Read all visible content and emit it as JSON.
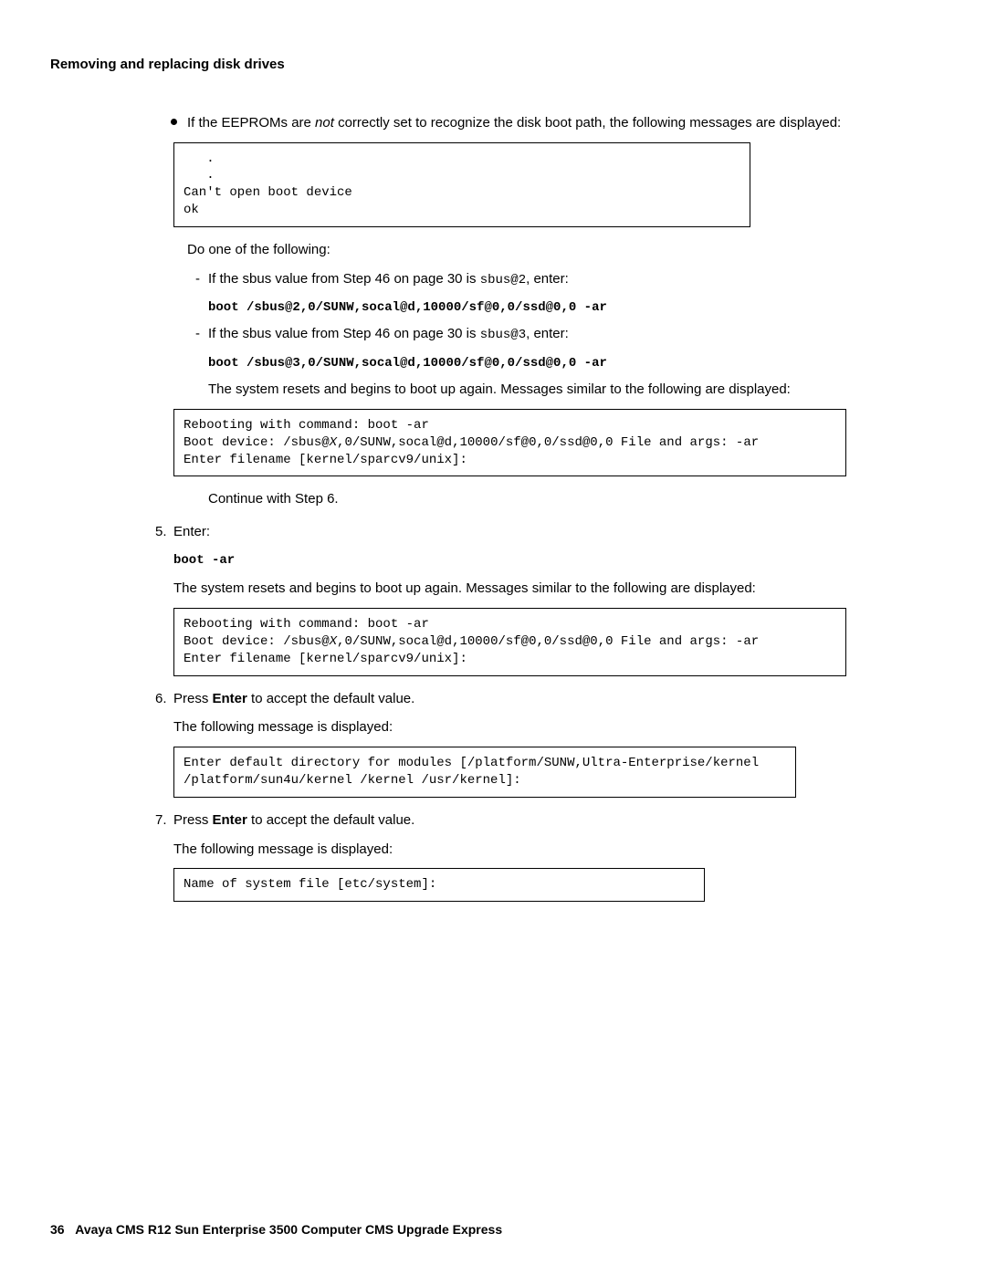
{
  "header": {
    "section": "Removing and replacing disk drives"
  },
  "bullet": {
    "text_a": "If the EEPROMs are ",
    "not": "not",
    "text_b": " correctly set to recognize the disk boot path, the following messages are displayed:"
  },
  "codebox1": "   .\n   .\nCan't open boot device\nok",
  "do_one": "Do one of the following:",
  "dash1_a": "If the sbus value from Step 46 on page 30 is ",
  "dash1_code": "sbus@2",
  "dash1_b": ", enter:",
  "cmd1": "boot /sbus@2,0/SUNW,socal@d,10000/sf@0,0/ssd@0,0 -ar",
  "dash2_a": "If the sbus value from Step 46 on page 30 is ",
  "dash2_code": "sbus@3",
  "dash2_b": ", enter:",
  "cmd2": "boot /sbus@3,0/SUNW,socal@d,10000/sf@0,0/ssd@0,0 -ar",
  "resets1": "The system resets and begins to boot up again. Messages similar to the following are displayed:",
  "codebox2_a": "Rebooting with command: boot -ar\nBoot device: /sbus@",
  "codebox2_x": "X",
  "codebox2_b": ",0/SUNW,socal@d,10000/sf@0,0/ssd@0,0 File and args: -ar\nEnter filename [kernel/sparcv9/unix]:",
  "continue6": "Continue with Step 6.",
  "step5_num": "5.",
  "step5_label": "Enter:",
  "step5_cmd": "boot -ar",
  "step5_text": "The system resets and begins to boot up again. Messages similar to the following are displayed:",
  "codebox3_a": "Rebooting with command: boot -ar\nBoot device: /sbus@",
  "codebox3_x": "X",
  "codebox3_b": ",0/SUNW,socal@d,10000/sf@0,0/ssd@0,0 File and args: -ar\nEnter filename [kernel/sparcv9/unix]:",
  "step6_num": "6.",
  "step6_a": "Press ",
  "step6_enter": "Enter",
  "step6_b": " to accept the default value.",
  "step6_text": "The following message is displayed:",
  "codebox4": "Enter default directory for modules [/platform/SUNW,Ultra-Enterprise/kernel \n/platform/sun4u/kernel /kernel /usr/kernel]:",
  "step7_num": "7.",
  "step7_a": "Press ",
  "step7_enter": "Enter",
  "step7_b": " to accept the default value.",
  "step7_text": "The following message is displayed:",
  "codebox5": "Name of system file [etc/system]:",
  "footer": {
    "page": "36",
    "title": "Avaya CMS R12 Sun Enterprise 3500 Computer CMS Upgrade Express"
  }
}
